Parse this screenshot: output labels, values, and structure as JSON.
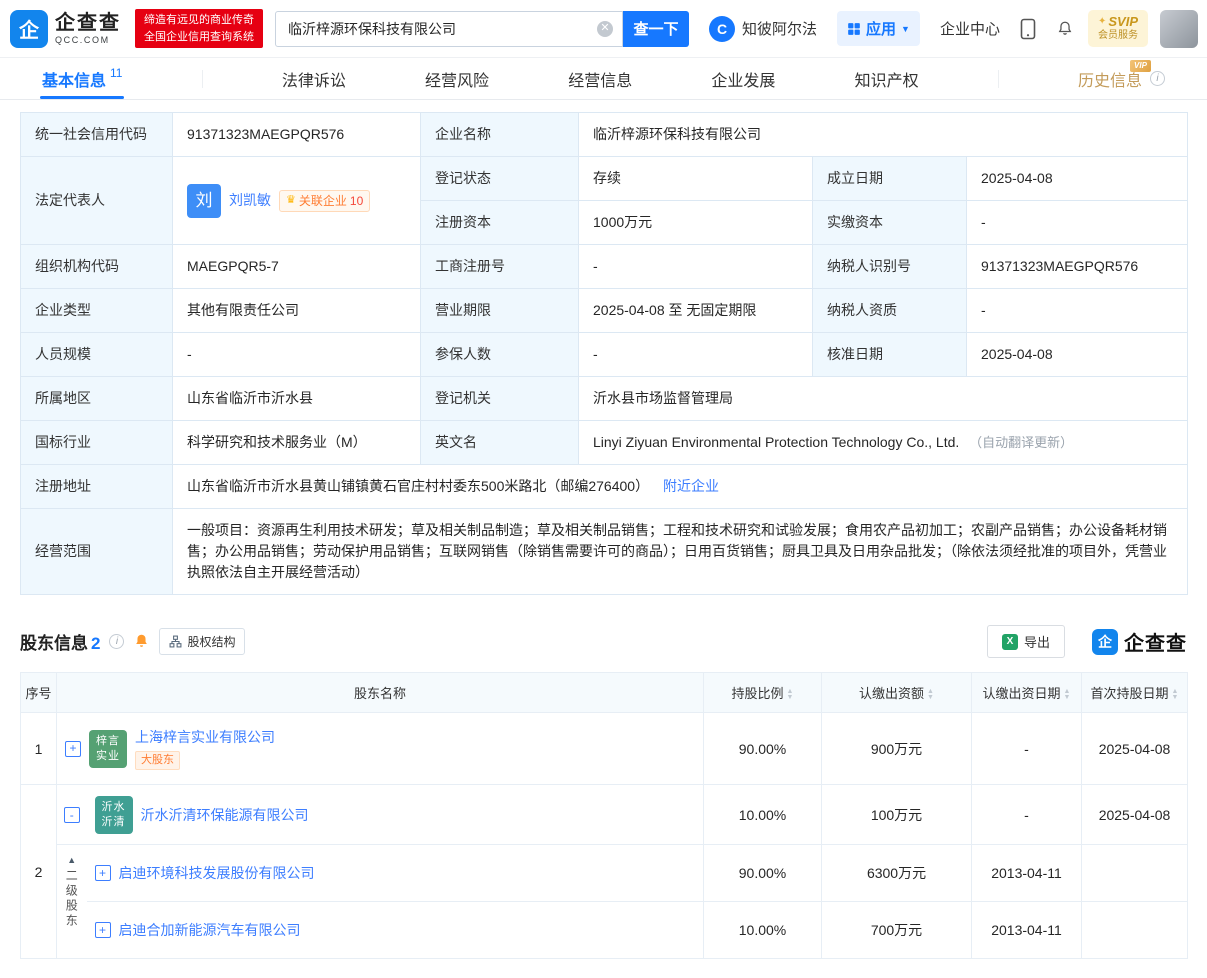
{
  "header": {
    "brand": {
      "name": "企查查",
      "domain": "QCC.COM"
    },
    "slogan": {
      "line1": "缔造有远见的商业传奇",
      "line2": "全国企业信用查询系统"
    },
    "search": {
      "value": "临沂梓源环保科技有限公司",
      "button_label": "查一下"
    },
    "nav": {
      "zhibi_label": "知彼阿尔法",
      "apps_label": "应用",
      "center_label": "企业中心"
    },
    "svip": {
      "title": "SVIP",
      "subtitle": "会员服务"
    }
  },
  "tabs": {
    "basic": {
      "label": "基本信息",
      "count": "11"
    },
    "legal": {
      "label": "法律诉讼"
    },
    "risk": {
      "label": "经营风险"
    },
    "operation": {
      "label": "经营信息"
    },
    "development": {
      "label": "企业发展"
    },
    "ip": {
      "label": "知识产权"
    },
    "history": {
      "label": "历史信息",
      "vip": "VIP"
    }
  },
  "basic_info": {
    "labels": {
      "credit_code": "统一社会信用代码",
      "company_name": "企业名称",
      "legal_rep": "法定代表人",
      "reg_status": "登记状态",
      "establish_date": "成立日期",
      "reg_capital": "注册资本",
      "paid_capital": "实缴资本",
      "org_code": "组织机构代码",
      "reg_no": "工商注册号",
      "taxpayer_id": "纳税人识别号",
      "company_type": "企业类型",
      "business_term": "营业期限",
      "taxpayer_qual": "纳税人资质",
      "staff_size": "人员规模",
      "insured_count": "参保人数",
      "approval_date": "核准日期",
      "region": "所属地区",
      "reg_authority": "登记机关",
      "industry": "国标行业",
      "english_name": "英文名",
      "address": "注册地址",
      "scope": "经营范围"
    },
    "values": {
      "credit_code": "91371323MAEGPQR576",
      "company_name": "临沂梓源环保科技有限公司",
      "reg_status": "存续",
      "establish_date": "2025-04-08",
      "reg_capital": "1000万元",
      "paid_capital": "-",
      "org_code": "MAEGPQR5-7",
      "reg_no": "-",
      "taxpayer_id": "91371323MAEGPQR576",
      "company_type": "其他有限责任公司",
      "business_term": "2025-04-08 至 无固定期限",
      "taxpayer_qual": "-",
      "staff_size": "-",
      "insured_count": "-",
      "approval_date": "2025-04-08",
      "region": "山东省临沂市沂水县",
      "reg_authority": "沂水县市场监督管理局",
      "industry": "科学研究和技术服务业（M）",
      "english_name": "Linyi Ziyuan Environmental Protection Technology Co., Ltd.",
      "english_note": "（自动翻译更新）",
      "address": "山东省临沂市沂水县黄山铺镇黄石官庄村村委东500米路北（邮编276400）",
      "nearby_link": "附近企业",
      "scope": "一般项目：资源再生利用技术研发；草及相关制品制造；草及相关制品销售；工程和技术研究和试验发展；食用农产品初加工；农副产品销售；办公设备耗材销售；办公用品销售；劳动保护用品销售；互联网销售（除销售需要许可的商品）；日用百货销售；厨具卫具及日用杂品批发；（除依法须经批准的项目外，凭营业执照依法自主开展经营活动）"
    },
    "legal_rep": {
      "avatar_text": "刘",
      "name": "刘凯敏",
      "related_label": "关联企业",
      "related_count": "10"
    }
  },
  "shareholders": {
    "title": "股东信息",
    "count": "2",
    "equity_button": "股权结构",
    "export_button": "导出",
    "brand": "企查查",
    "columns": [
      "序号",
      "股东名称",
      "持股比例",
      "认缴出资额",
      "认缴出资日期",
      "首次持股日期"
    ],
    "rows": [
      {
        "no": "1",
        "expand": "+",
        "avatar_line1": "梓言",
        "avatar_line2": "实业",
        "name": "上海梓言实业有限公司",
        "tag": "大股东",
        "ratio": "90.00%",
        "amount": "900万元",
        "sub_date": "-",
        "first_date": "2025-04-08"
      },
      {
        "no": "2",
        "expand": "-",
        "avatar_line1": "沂水",
        "avatar_line2": "沂清",
        "name": "沂水沂清环保能源有限公司",
        "ratio": "10.00%",
        "amount": "100万元",
        "sub_date": "-",
        "first_date": "2025-04-08"
      },
      {
        "group_label": "二级股东",
        "expand": "+",
        "name": "启迪环境科技发展股份有限公司",
        "ratio": "90.00%",
        "amount": "6300万元",
        "sub_date": "2013-04-11",
        "first_date": ""
      },
      {
        "expand": "+",
        "name": "启迪合加新能源汽车有限公司",
        "ratio": "10.00%",
        "amount": "700万元",
        "sub_date": "2013-04-11",
        "first_date": ""
      }
    ]
  }
}
